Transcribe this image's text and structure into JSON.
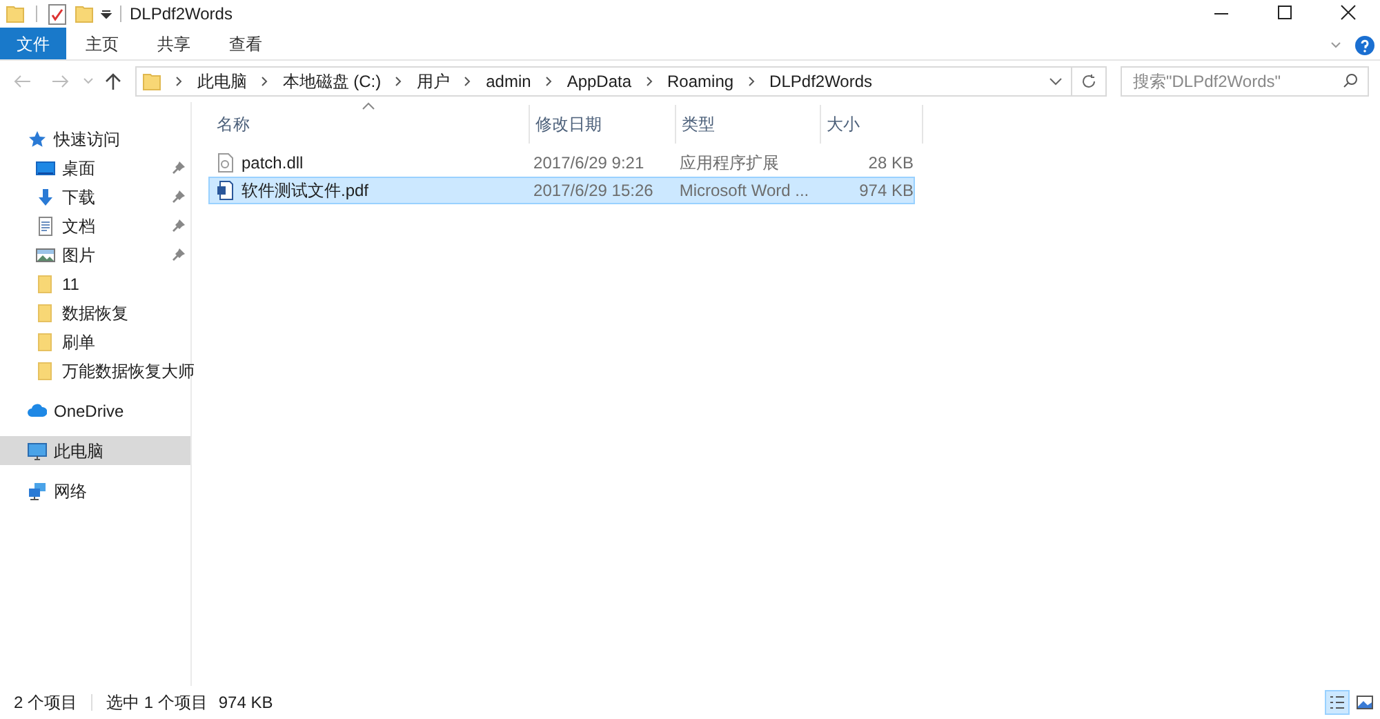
{
  "window": {
    "title": "DLPdf2Words"
  },
  "ribbon_tabs": [
    {
      "label": "文件",
      "kind": "file"
    },
    {
      "label": "主页",
      "kind": "tab"
    },
    {
      "label": "共享",
      "kind": "tab"
    },
    {
      "label": "查看",
      "kind": "tab"
    }
  ],
  "breadcrumb": [
    "此电脑",
    "本地磁盘 (C:)",
    "用户",
    "admin",
    "AppData",
    "Roaming",
    "DLPdf2Words"
  ],
  "search": {
    "placeholder": "搜索\"DLPdf2Words\""
  },
  "sidebar": {
    "items": [
      {
        "label": "快速访问",
        "kind": "star",
        "pinned": false,
        "selected": false,
        "children": [
          {
            "label": "桌面",
            "kind": "desktop",
            "pinned": true,
            "selected": false
          },
          {
            "label": "下载",
            "kind": "download",
            "pinned": true,
            "selected": false
          },
          {
            "label": "文档",
            "kind": "document",
            "pinned": true,
            "selected": false
          },
          {
            "label": "图片",
            "kind": "image",
            "pinned": true,
            "selected": false
          },
          {
            "label": "11",
            "kind": "folder",
            "pinned": false,
            "selected": false
          },
          {
            "label": "数据恢复",
            "kind": "folder",
            "pinned": false,
            "selected": false
          },
          {
            "label": "刷单",
            "kind": "folder",
            "pinned": false,
            "selected": false
          },
          {
            "label": "万能数据恢复大师",
            "kind": "folder",
            "pinned": false,
            "selected": false
          }
        ]
      },
      {
        "label": "OneDrive",
        "kind": "cloud",
        "pinned": false,
        "selected": false
      },
      {
        "label": "此电脑",
        "kind": "pc",
        "pinned": false,
        "selected": true
      },
      {
        "label": "网络",
        "kind": "network",
        "pinned": false,
        "selected": false
      }
    ]
  },
  "table": {
    "columns": [
      "名称",
      "修改日期",
      "类型",
      "大小"
    ],
    "rows": [
      {
        "name": "patch.dll",
        "kind": "dll",
        "modified": "2017/6/29 9:21",
        "type": "应用程序扩展",
        "size": "28 KB",
        "selected": false
      },
      {
        "name": "软件测试文件.pdf",
        "kind": "word",
        "modified": "2017/6/29 15:26",
        "type": "Microsoft Word ...",
        "size": "974 KB",
        "selected": true
      }
    ]
  },
  "status_bar": {
    "count": "2 个项目",
    "selection": "选中 1 个项目",
    "selection_size": "974 KB"
  }
}
